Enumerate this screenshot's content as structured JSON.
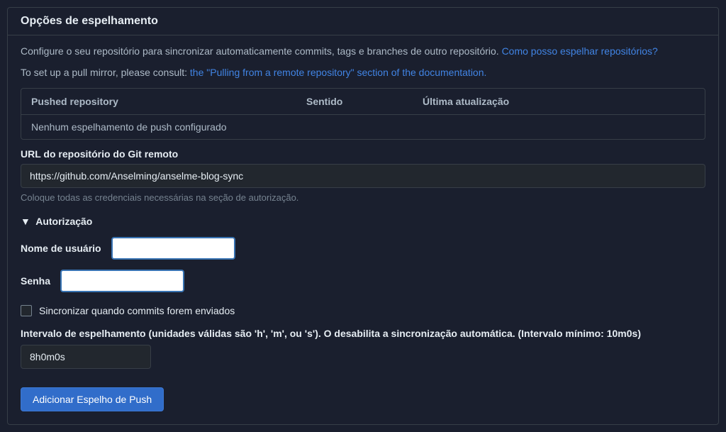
{
  "panel": {
    "title": "Opções de espelhamento"
  },
  "intro": {
    "text": "Configure o seu repositório para sincronizar automaticamente commits, tags e branches de outro repositório. ",
    "link": "Como posso espelhar repositórios?"
  },
  "setup": {
    "text": "To set up a pull mirror, please consult: ",
    "link": "the \"Pulling from a remote repository\" section of the documentation."
  },
  "table": {
    "headers": {
      "repo": "Pushed repository",
      "direction": "Sentido",
      "updated": "Última atualização"
    },
    "empty_row": "Nenhum espelhamento de push configurado"
  },
  "form": {
    "url_label": "URL do repositório do Git remoto",
    "url_value": "https://github.com/Anselming/anselme-blog-sync",
    "url_help": "Coloque todas as credenciais necessárias na seção de autorização."
  },
  "auth": {
    "section_title": "Autorização",
    "username_label": "Nome de usuário",
    "username_value": "",
    "password_label": "Senha",
    "password_value": ""
  },
  "sync_checkbox": {
    "label": "Sincronizar quando commits forem enviados"
  },
  "interval": {
    "label": "Intervalo de espelhamento (unidades válidas são 'h', 'm', ou 's'). O desabilita a sincronização automática. (Intervalo mínimo: 10m0s)",
    "value": "8h0m0s"
  },
  "button": {
    "label": "Adicionar Espelho de Push"
  }
}
